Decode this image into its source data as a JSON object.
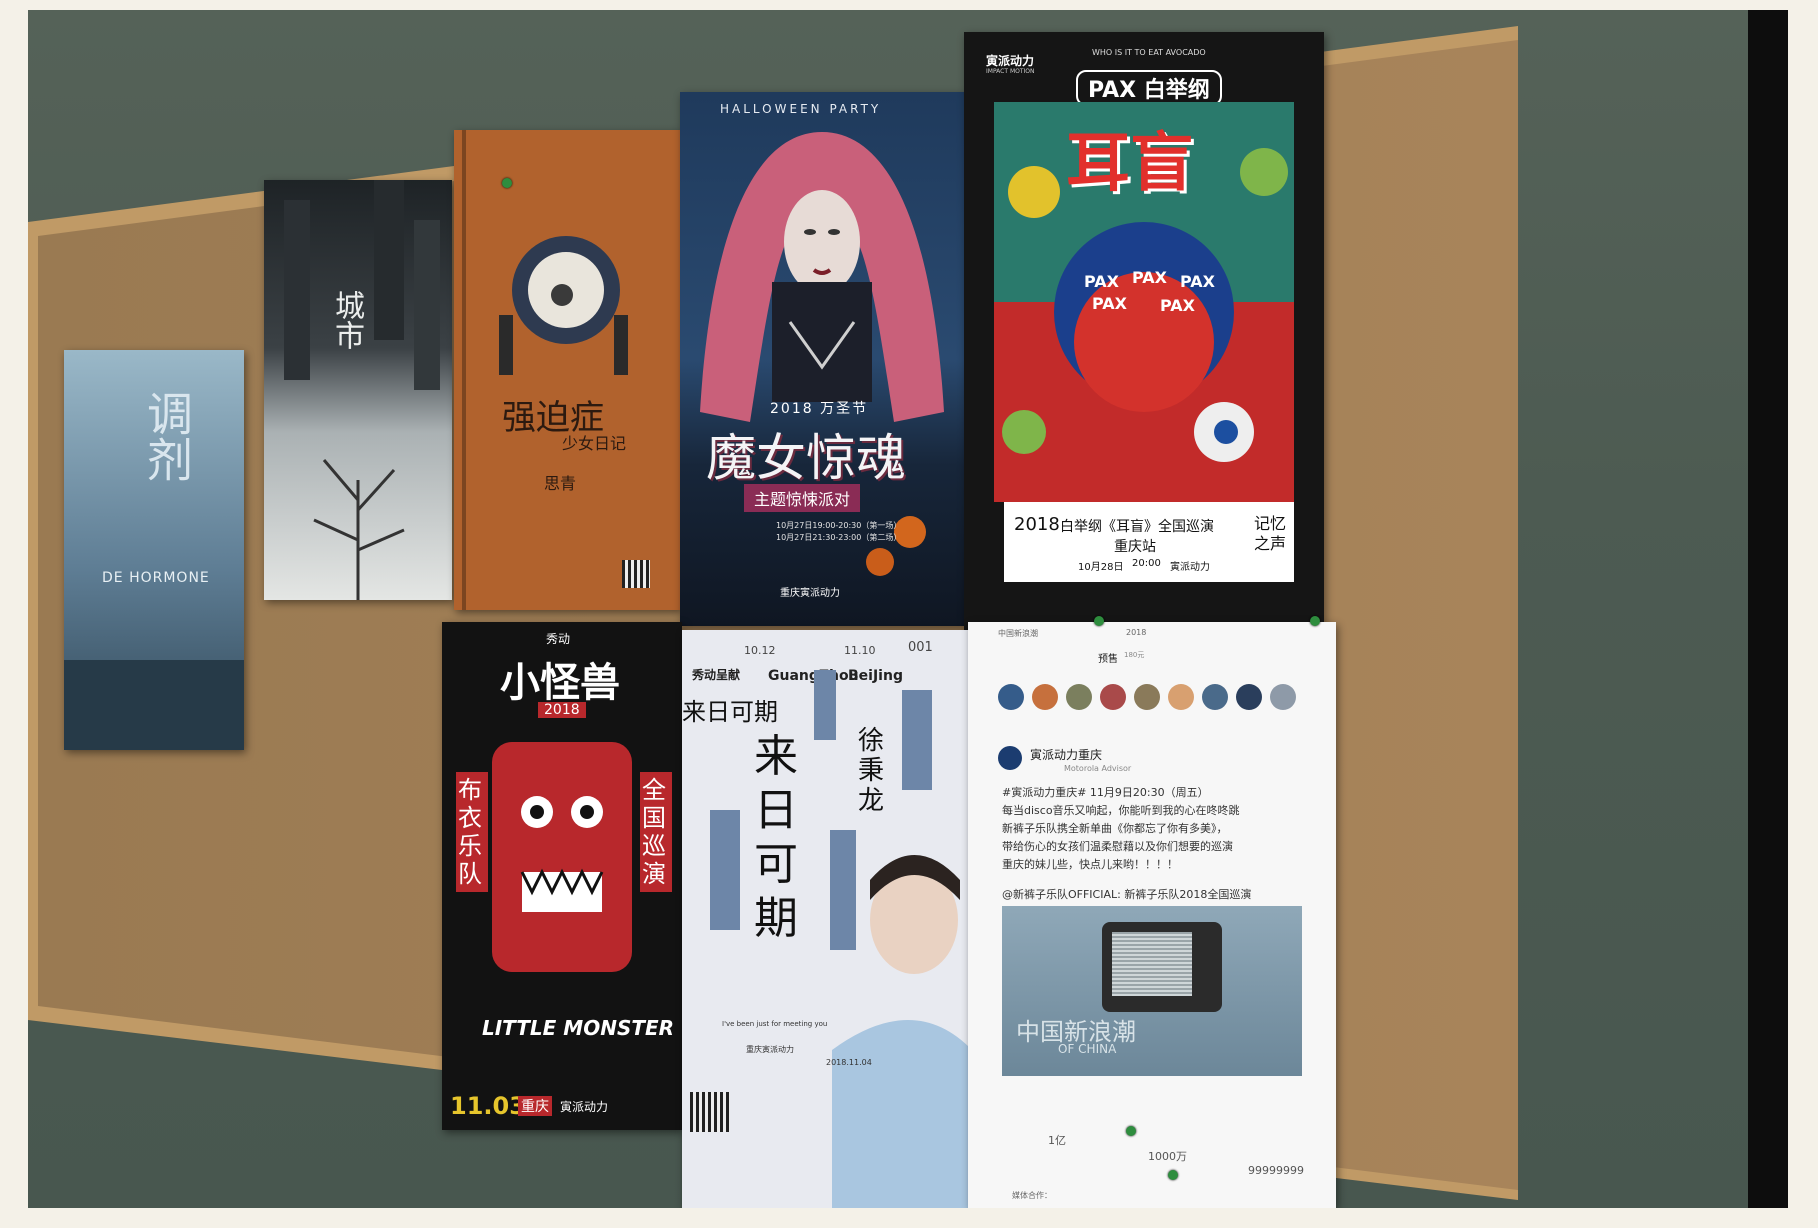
{
  "photo": {
    "colors": {
      "wall": "#4f5d54",
      "cork": "#a98255",
      "frame": "#c9a06a",
      "film_border": "#f4f1e8"
    }
  },
  "poster_blue": {
    "title_vertical": "调剂",
    "subtitle": "DE HORMONE"
  },
  "poster_city": {
    "title_vertical": "城市"
  },
  "poster_orange": {
    "title": "强迫症",
    "subtitle": "少女日记",
    "label": "思青"
  },
  "poster_halloween": {
    "header": "HALLOWEEN PARTY",
    "year_line": "2018 万圣节",
    "title": "魔女惊魂",
    "subtitle": "主题惊悚派对",
    "date1": "10月27日19:00-20:30（第一场）",
    "date2": "10月27日21:30-23:00（第二场）",
    "organizer": "重庆寅派动力"
  },
  "poster_pax": {
    "brand": "寅派动力",
    "brand_sub": "IMPACT MOTION",
    "tagline": "WHO IS IT TO EAT AVOCADO",
    "band_logo": "PAX 白举纲",
    "title": "耳盲",
    "pax_words": [
      "PAX",
      "PAX",
      "PAX",
      "PAX",
      "PAX"
    ],
    "year": "2018",
    "tour": "白举纲《耳盲》全国巡演",
    "station": "重庆站",
    "date": "10月28日",
    "time": "20:00",
    "organizer": "寅派动力",
    "side_text": "记忆之声"
  },
  "poster_monster": {
    "sponsor": "秀动",
    "title": "小怪兽",
    "year": "2018",
    "left_text": "布衣乐队",
    "right_text": "全国巡演",
    "english": "LITTLE MONSTER",
    "date": "11.03",
    "city": "重庆",
    "organizer": "寅派动力"
  },
  "poster_xu": {
    "brand": "秀动呈献",
    "date1": "10.12",
    "city1": "GuangZhou",
    "date2": "11.10",
    "city2": "BeiJing",
    "number": "001",
    "title_line": "来日可期",
    "title_big": "来日可期",
    "name": "徐秉龙",
    "english": "I've been just for meeting you",
    "date": "2018.11.04",
    "organizer": "重庆寅派动力"
  },
  "poster_weibo": {
    "status": "中国新浪潮",
    "year": "2018",
    "tab_active": "预售",
    "tab_other": "180元",
    "account": "寅派动力重庆",
    "account_sub": "Motorola Advisor",
    "hashtag": "#寅派动力重庆# 11月9日20:30（周五）",
    "line1": "每当disco音乐又响起，你能听到我的心在咚咚跳",
    "line2": "新裤子乐队携全新单曲《你都忘了你有多美》，",
    "line3": "带给伤心的女孩们温柔慰藉以及你们想要的巡演",
    "line4": "重庆的妹儿些，快点儿来哟！！！！",
    "mention": "@新裤子乐队OFFICIAL: 新裤子乐队2018全国巡演",
    "video_caption": "中国新浪潮",
    "video_sub": "OF CHINA",
    "reposts": "1亿",
    "comments": "1000万",
    "likes": "99999999",
    "footer": "媒体合作："
  }
}
